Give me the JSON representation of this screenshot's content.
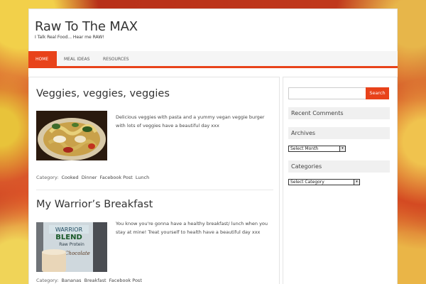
{
  "site": {
    "title": "Raw To The MAX",
    "description": "I Talk Real Food... Hear me RAW!"
  },
  "nav": {
    "items": [
      {
        "label": "Home",
        "active": true
      },
      {
        "label": "Meal Ideas",
        "active": false
      },
      {
        "label": "Resources",
        "active": false
      }
    ]
  },
  "posts": [
    {
      "title": "Veggies, veggies, veggies",
      "excerpt": "Delicious veggies with pasta and a yummy vegan veggie burger with lots of veggies have a beautiful day xxx",
      "category_label": "Category:",
      "categories": [
        "Cooked",
        "Dinner",
        "Facebook Post",
        "Lunch"
      ]
    },
    {
      "title": "My Warrior’s Breakfast",
      "excerpt": "You know you're gonna have a healthy breakfast/ lunch when you stay at mine! Treat yourself to health have a beautiful day xxx",
      "category_label": "Category:",
      "categories": [
        "Bananas",
        "Breakfast",
        "Facebook Post"
      ],
      "thumb_text": [
        "WARRIOR",
        "BLEND",
        "Raw Protein",
        "Chocolate"
      ]
    }
  ],
  "sidebar": {
    "search": {
      "placeholder": "",
      "button_label": "Search"
    },
    "recent_comments_title": "Recent Comments",
    "archives_title": "Archives",
    "archives_select": "Select Month",
    "categories_title": "Categories",
    "categories_select": "Select Category"
  }
}
